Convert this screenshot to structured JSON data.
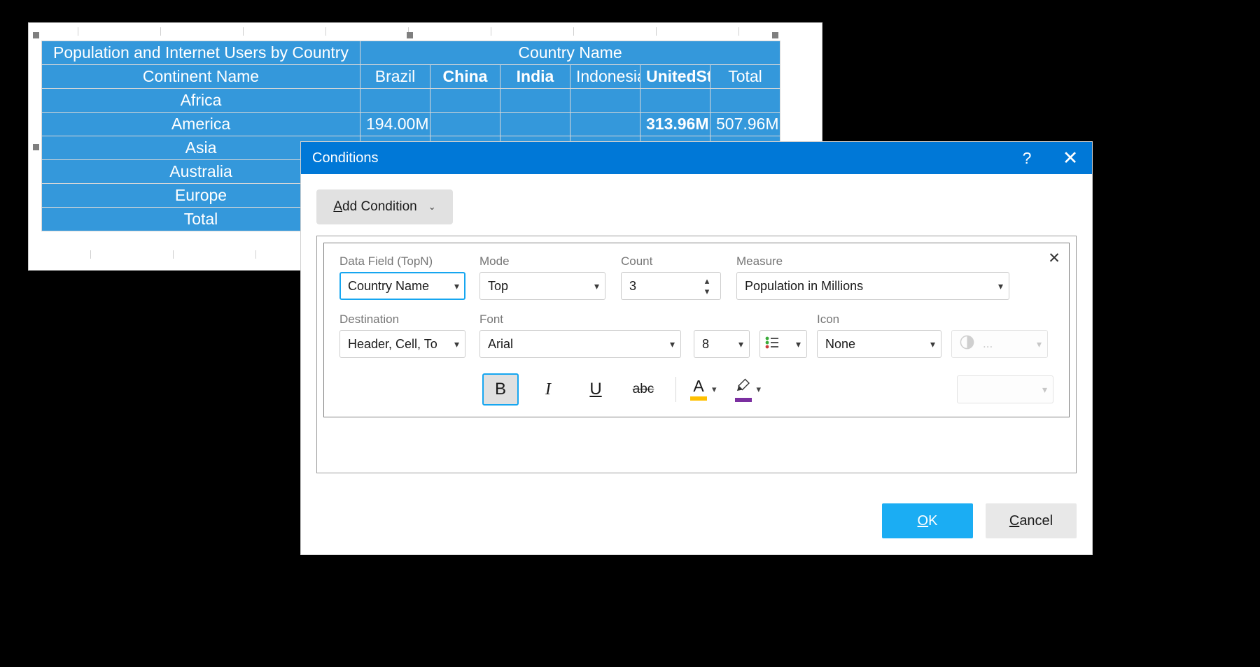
{
  "spreadsheet": {
    "title_cell": "Population and Internet Users by Country",
    "country_group_header": "Country Name",
    "row_header": "Continent Name",
    "columns": [
      "Brazil",
      "China",
      "India",
      "Indonesia",
      "UnitedStates",
      "Total"
    ],
    "highlighted_columns": [
      "China",
      "India",
      "UnitedStates"
    ],
    "rows": [
      {
        "continent": "Africa",
        "values": [
          "",
          "",
          "",
          "",
          "",
          ""
        ]
      },
      {
        "continent": "America",
        "values": [
          "194.00M",
          "",
          "",
          "",
          "313.96M",
          "507.96M"
        ]
      },
      {
        "continent": "Asia",
        "values": [
          "",
          "",
          "",
          "",
          "",
          ""
        ]
      },
      {
        "continent": "Australia",
        "values": [
          "",
          "",
          "",
          "",
          "",
          ""
        ]
      },
      {
        "continent": "Europe",
        "values": [
          "",
          "",
          "",
          "",
          "",
          ""
        ]
      },
      {
        "continent": "Total",
        "values": [
          "",
          "",
          "",
          "",
          "",
          ""
        ]
      }
    ],
    "colors": {
      "header_blue": "#3498db",
      "highlight_purple": "#7b2fa0",
      "highlight_text": "#ffc000",
      "row_alt_gray": "#ececec"
    }
  },
  "dialog": {
    "title": "Conditions",
    "help_icon": "?",
    "close_icon": "✕",
    "add_condition": {
      "accel": "A",
      "rest": "dd Condition",
      "chevron": "⌄"
    },
    "condition": {
      "close_icon": "✕",
      "fields": {
        "data_field": {
          "label": "Data Field (TopN)",
          "value": "Country Name",
          "focused": true
        },
        "mode": {
          "label": "Mode",
          "value": "Top"
        },
        "count": {
          "label": "Count",
          "value": "3"
        },
        "measure": {
          "label": "Measure",
          "value": "Population in Millions"
        },
        "destination": {
          "label": "Destination",
          "value": "Header, Cell, To"
        },
        "font": {
          "label": "Font",
          "value": "Arial"
        },
        "font_size": {
          "value": "8"
        },
        "list_style": {
          "icon": "list-style-icon"
        },
        "icon": {
          "label": "Icon",
          "value": "None"
        },
        "icon_preview": {
          "icon": "contrast-circle-icon",
          "ellipsis": "..."
        },
        "color_preview": {
          "value": ""
        }
      },
      "format_buttons": [
        {
          "name": "bold",
          "glyph": "B",
          "active": true
        },
        {
          "name": "italic",
          "glyph": "I",
          "active": false
        },
        {
          "name": "underline",
          "glyph": "U",
          "active": false
        },
        {
          "name": "strikethrough",
          "glyph": "abc",
          "active": false
        }
      ],
      "font_color": {
        "glyph": "A",
        "bar_color": "#ffc000"
      },
      "highlight_color": {
        "glyph": "✎",
        "bar_color": "#7b2fa0"
      }
    },
    "buttons": {
      "ok": {
        "accel": "O",
        "rest": "K"
      },
      "cancel": {
        "accel": "C",
        "rest": "ancel"
      }
    },
    "colors": {
      "titlebar": "#0078d7",
      "primary": "#1badf3",
      "focus": "#16a6f0"
    }
  }
}
